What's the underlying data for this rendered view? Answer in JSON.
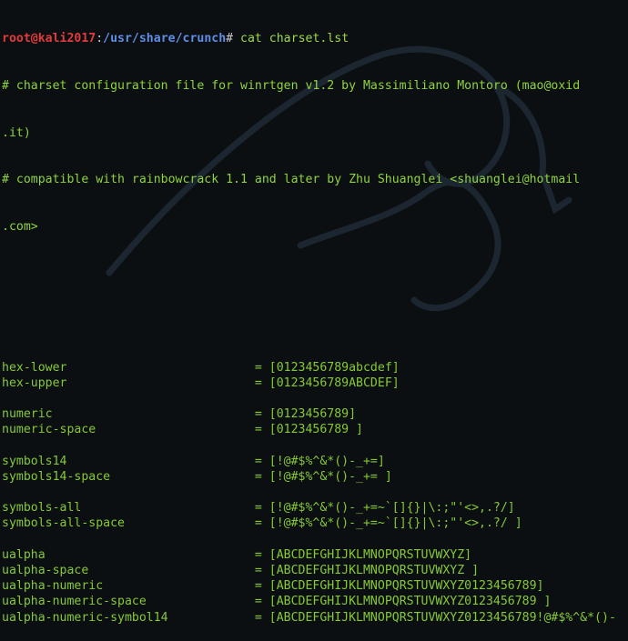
{
  "terminal": {
    "prompt": {
      "user_host": "root@kali2017",
      "separator": ":",
      "path": "/usr/share/crunch",
      "symbol": "#",
      "command": " cat charset.lst"
    },
    "comments": [
      "# charset configuration file for winrtgen v1.2 by Massimiliano Montoro (mao@oxid",
      ".it)",
      "# compatible with rainbowcrack 1.1 and later by Zhu Shuanglei <shuanglei@hotmail",
      ".com>"
    ],
    "charset_groups": [
      [
        {
          "name": "hex-lower",
          "value": "[0123456789abcdef]"
        },
        {
          "name": "hex-upper",
          "value": "[0123456789ABCDEF]"
        }
      ],
      [
        {
          "name": "numeric",
          "value": "[0123456789]"
        },
        {
          "name": "numeric-space",
          "value": "[0123456789 ]"
        }
      ],
      [
        {
          "name": "symbols14",
          "value": "[!@#$%^&*()-_+=]"
        },
        {
          "name": "symbols14-space",
          "value": "[!@#$%^&*()-_+= ]"
        }
      ],
      [
        {
          "name": "symbols-all",
          "value": "[!@#$%^&*()-_+=~`[]{}|\\:;\"'<>,.?/]"
        },
        {
          "name": "symbols-all-space",
          "value": "[!@#$%^&*()-_+=~`[]{}|\\:;\"'<>,.?/ ]"
        }
      ],
      [
        {
          "name": "ualpha",
          "value": "[ABCDEFGHIJKLMNOPQRSTUVWXYZ]"
        },
        {
          "name": "ualpha-space",
          "value": "[ABCDEFGHIJKLMNOPQRSTUVWXYZ ]"
        },
        {
          "name": "ualpha-numeric",
          "value": "[ABCDEFGHIJKLMNOPQRSTUVWXYZ0123456789]"
        },
        {
          "name": "ualpha-numeric-space",
          "value": "[ABCDEFGHIJKLMNOPQRSTUVWXYZ0123456789 ]"
        },
        {
          "name": "ualpha-numeric-symbol14",
          "value": "[ABCDEFGHIJKLMNOPQRSTUVWXYZ0123456789!@#$%^&*()-"
        }
      ]
    ],
    "equals_sign": "=",
    "colors": {
      "background": "#0b0f12",
      "prompt_user": "#e33b3b",
      "prompt_path": "#5e8ee6",
      "text_green": "#86c935"
    }
  }
}
